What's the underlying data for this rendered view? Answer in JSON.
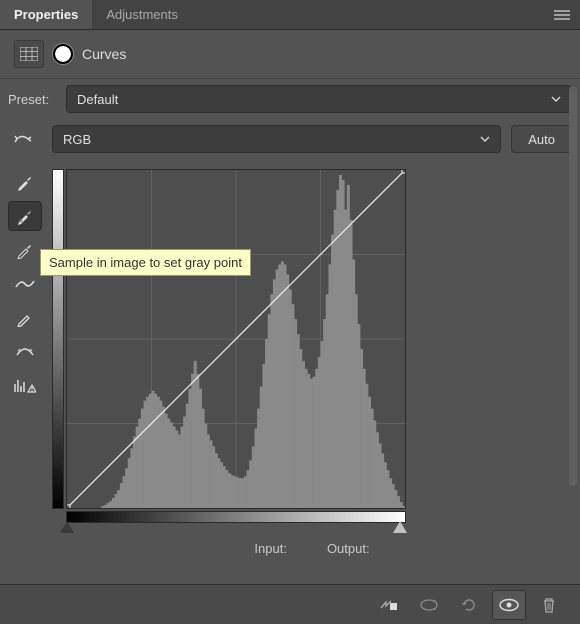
{
  "tabs": {
    "properties": "Properties",
    "adjustments": "Adjustments"
  },
  "section": "Curves",
  "preset": {
    "label": "Preset:",
    "value": "Default"
  },
  "channel": {
    "value": "RGB",
    "auto": "Auto"
  },
  "tooltip": "Sample in image to set gray point",
  "io": {
    "input": "Input:",
    "output": "Output:"
  },
  "chart_data": {
    "type": "curves-histogram",
    "grid": 4,
    "curve_points": [
      [
        0,
        0
      ],
      [
        255,
        255
      ]
    ],
    "histogram_bins": 128,
    "histogram_max": 340,
    "histogram": [
      0,
      0,
      0,
      0,
      0,
      0,
      0,
      0,
      0,
      0,
      0,
      0,
      0,
      2,
      3,
      5,
      7,
      10,
      14,
      18,
      25,
      32,
      40,
      50,
      60,
      72,
      82,
      90,
      100,
      108,
      112,
      115,
      118,
      115,
      112,
      108,
      102,
      95,
      90,
      86,
      82,
      78,
      74,
      82,
      92,
      105,
      120,
      135,
      148,
      135,
      120,
      100,
      85,
      74,
      68,
      62,
      55,
      50,
      46,
      42,
      38,
      35,
      33,
      32,
      31,
      30,
      30,
      32,
      38,
      48,
      62,
      80,
      100,
      122,
      145,
      170,
      195,
      215,
      230,
      240,
      245,
      248,
      245,
      235,
      220,
      205,
      190,
      175,
      160,
      148,
      140,
      135,
      130,
      132,
      140,
      152,
      168,
      190,
      215,
      245,
      275,
      300,
      320,
      335,
      330,
      300,
      325,
      290,
      250,
      215,
      185,
      160,
      140,
      125,
      112,
      100,
      88,
      76,
      65,
      55,
      46,
      38,
      30,
      24,
      18,
      12,
      6,
      2
    ]
  }
}
